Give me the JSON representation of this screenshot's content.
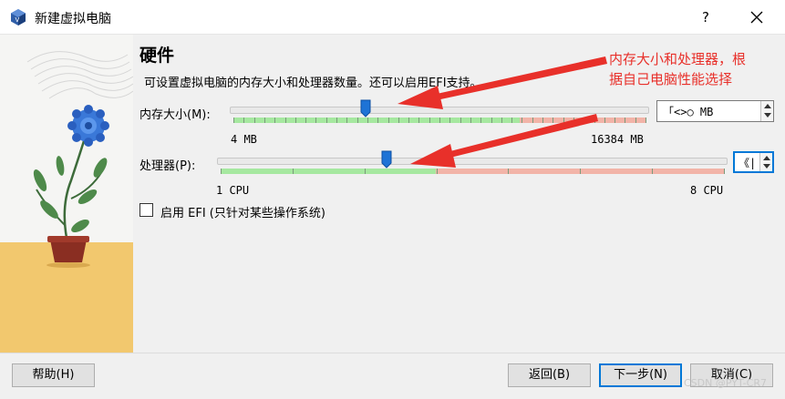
{
  "window": {
    "title": "新建虚拟电脑",
    "help_glyph": "?",
    "close_glyph": "✕"
  },
  "header": {
    "title": "硬件",
    "description": "可设置虚拟电脑的内存大小和处理器数量。还可以启用EFI支持。"
  },
  "memory": {
    "label": "内存大小(M):",
    "min_label": "4 MB",
    "max_label": "16384 MB",
    "value_text": "「<>○ MB",
    "slider_level": 0.32
  },
  "processor": {
    "label": "处理器(P):",
    "min_label": "1 CPU",
    "max_label": "8 CPU",
    "value_text": "《|",
    "slider_level": 0.33
  },
  "efi": {
    "label": "启用 EFI (只针对某些操作系统)",
    "checked": false
  },
  "annotation": {
    "line1": "内存大小和处理器，根",
    "line2": "据自己电脑性能选择",
    "color": "#e8302a"
  },
  "footer": {
    "help_label": "帮助(H)",
    "back_label": "返回(B)",
    "next_label": "下一步(N)",
    "cancel_label": "取消(C)"
  },
  "watermark": "CSDN @PYT-CR7",
  "colors": {
    "slider_green": "#a6e8a0",
    "slider_red": "#f2b4a8",
    "thumb_blue": "#1e73d6",
    "focus_blue": "#0078d7"
  }
}
